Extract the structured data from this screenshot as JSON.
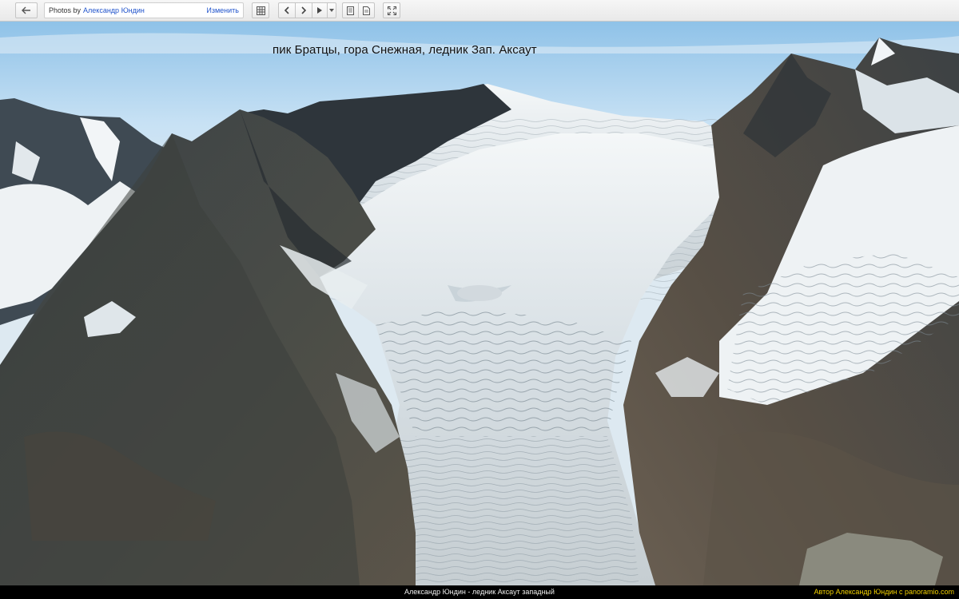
{
  "toolbar": {
    "back_icon": "back-arrow-icon",
    "photos_by_label": "Photos by",
    "author_name": "Александр Юндин",
    "edit_label": "Изменить",
    "grid_icon": "grid-icon",
    "prev_icon": "chevron-left-icon",
    "next_icon": "chevron-right-icon",
    "play_icon": "play-icon",
    "dropdown_icon": "caret-down-icon",
    "info_icon": "info-panel-icon",
    "details_icon": "document-icon",
    "fullscreen_icon": "fullscreen-icon"
  },
  "photo": {
    "overlay_caption": "пик Братцы, гора Снежная, ледник Зап. Аксаут",
    "alt": "ледник Аксаут западный"
  },
  "footer": {
    "caption": "Александр Юндин - ледник Аксаут западный",
    "attribution": "Автор Александр Юндин с panoramio.com"
  },
  "colors": {
    "sky_top": "#9fcaea",
    "attribution": "#f2d000",
    "link": "#2255cc"
  }
}
